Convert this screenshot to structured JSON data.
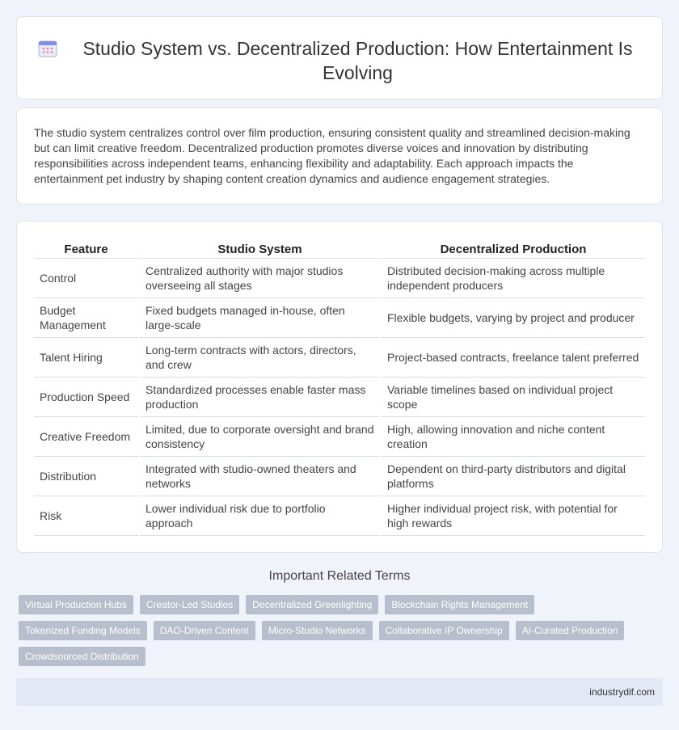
{
  "title": "Studio System vs. Decentralized Production: How Entertainment Is Evolving",
  "intro": "The studio system centralizes control over film production, ensuring consistent quality and streamlined decision-making but can limit creative freedom. Decentralized production promotes diverse voices and innovation by distributing responsibilities across independent teams, enhancing flexibility and adaptability. Each approach impacts the entertainment pet industry by shaping content creation dynamics and audience engagement strategies.",
  "table": {
    "headers": [
      "Feature",
      "Studio System",
      "Decentralized Production"
    ],
    "rows": [
      [
        "Control",
        "Centralized authority with major studios overseeing all stages",
        "Distributed decision-making across multiple independent producers"
      ],
      [
        "Budget Management",
        "Fixed budgets managed in-house, often large-scale",
        "Flexible budgets, varying by project and producer"
      ],
      [
        "Talent Hiring",
        "Long-term contracts with actors, directors, and crew",
        "Project-based contracts, freelance talent preferred"
      ],
      [
        "Production Speed",
        "Standardized processes enable faster mass production",
        "Variable timelines based on individual project scope"
      ],
      [
        "Creative Freedom",
        "Limited, due to corporate oversight and brand consistency",
        "High, allowing innovation and niche content creation"
      ],
      [
        "Distribution",
        "Integrated with studio-owned theaters and networks",
        "Dependent on third-party distributors and digital platforms"
      ],
      [
        "Risk",
        "Lower individual risk due to portfolio approach",
        "Higher individual project risk, with potential for high rewards"
      ]
    ]
  },
  "related": {
    "title": "Important Related Terms",
    "tags": [
      "Virtual Production Hubs",
      "Creator-Led Studios",
      "Decentralized Greenlighting",
      "Blockchain Rights Management",
      "Tokenized Funding Models",
      "DAO-Driven Content",
      "Micro-Studio Networks",
      "Collaborative IP Ownership",
      "AI-Curated Production",
      "Crowdsourced Distribution"
    ]
  },
  "footer": "industrydif.com",
  "icon": "calendar-grid-icon",
  "colors": {
    "accent": "#6f7fe0",
    "tag_bg": "#b7bfcc",
    "footer_bg": "#e3e9f4",
    "page_bg": "#f0f3f9"
  }
}
